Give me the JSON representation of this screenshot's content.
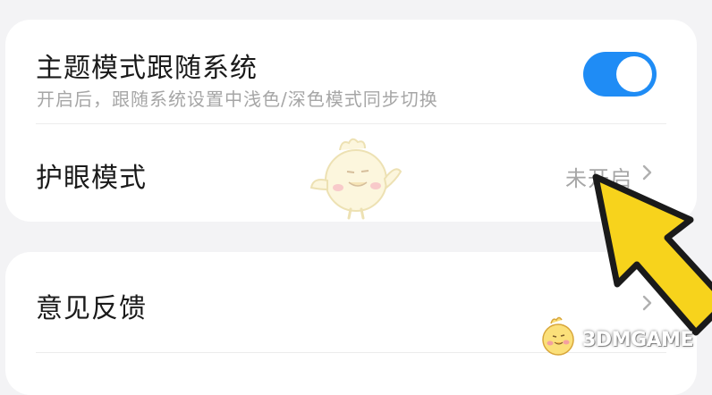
{
  "settings": {
    "group1": {
      "theme_follow_system": {
        "label": "主题模式跟随系统",
        "description": "开启后，跟随系统设置中浅色/深色模式同步切换",
        "enabled": true
      },
      "eye_care_mode": {
        "label": "护眼模式",
        "status": "未开启"
      }
    },
    "group2": {
      "feedback": {
        "label": "意见反馈"
      }
    }
  },
  "watermark": {
    "text": "3DMGAME"
  },
  "colors": {
    "background": "#f3f3f5",
    "card": "#ffffff",
    "toggle_on": "#1f8cf5",
    "primary_text": "#1a1a1a",
    "secondary_text": "#a6a6a6",
    "annotation_arrow": "#f7d31c"
  },
  "icons": {
    "chevron": "chevron-right-icon",
    "annotation": "yellow-arrow-pointer",
    "mascot": "chick-mascot-logo"
  }
}
